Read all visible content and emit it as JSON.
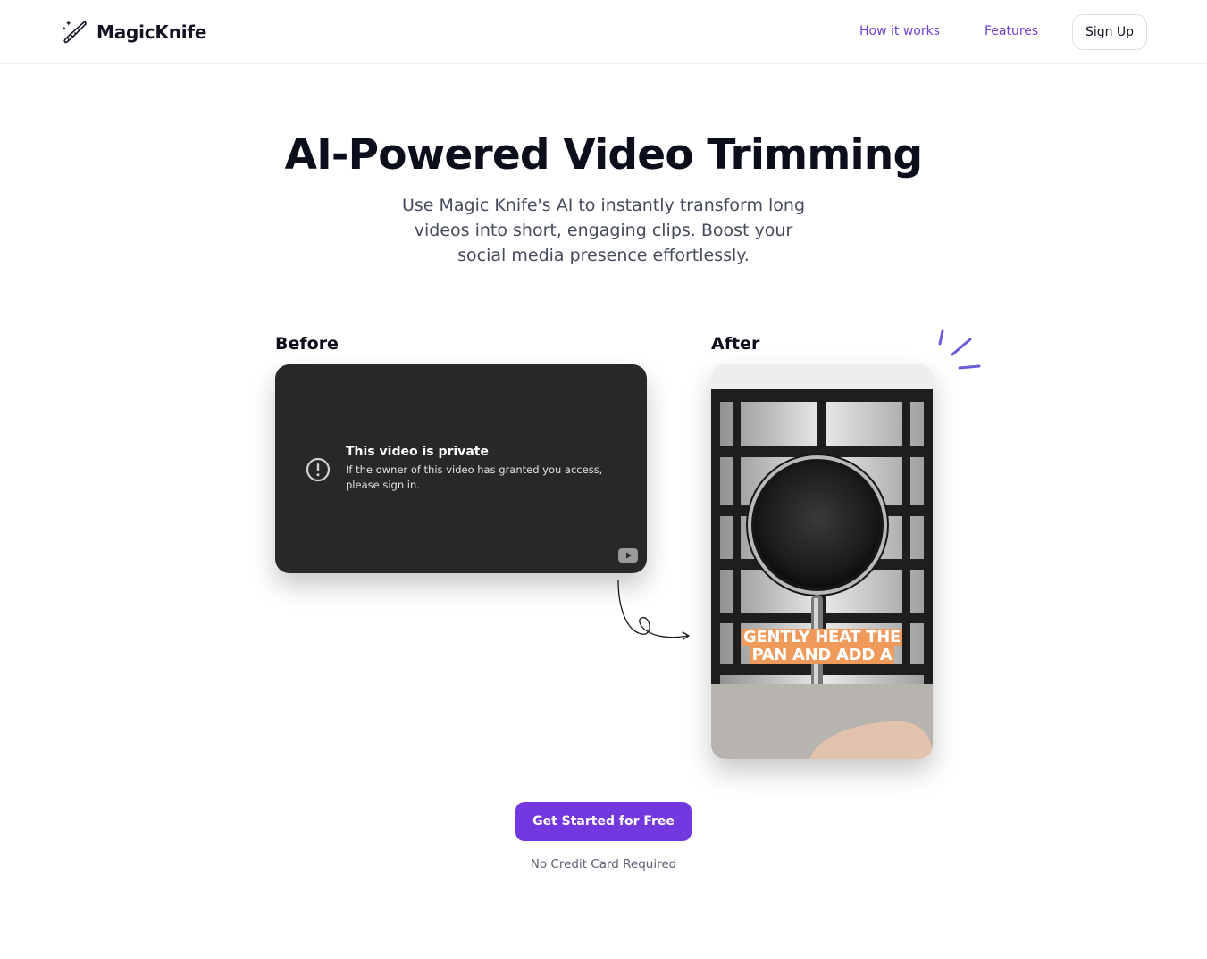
{
  "header": {
    "logo_text": "MagicKnife",
    "logo_icon": "knife-sparkle-icon",
    "nav": [
      {
        "label": "How it works"
      },
      {
        "label": "Features"
      }
    ],
    "signup_label": "Sign Up"
  },
  "hero": {
    "title": "AI-Powered Video Trimming",
    "subtitle": "Use Magic Knife's AI to instantly transform long videos into short, engaging clips. Boost your social media presence effortlessly."
  },
  "before": {
    "label": "Before",
    "video_title": "This video is private",
    "video_message": "If the owner of this video has granted you access, please sign in.",
    "icon": "exclamation-circle-icon",
    "player_icon": "youtube-icon"
  },
  "after": {
    "label": "After",
    "caption_lines": [
      "GENTLY HEAT THE",
      "PAN AND ADD A"
    ],
    "caption_color": "#ef9a5a"
  },
  "cta": {
    "label": "Get Started for Free",
    "note": "No Credit Card Required",
    "color": "#7337df"
  },
  "colors": {
    "accent": "#6f3fce",
    "decoration": "#6a5ed8"
  }
}
